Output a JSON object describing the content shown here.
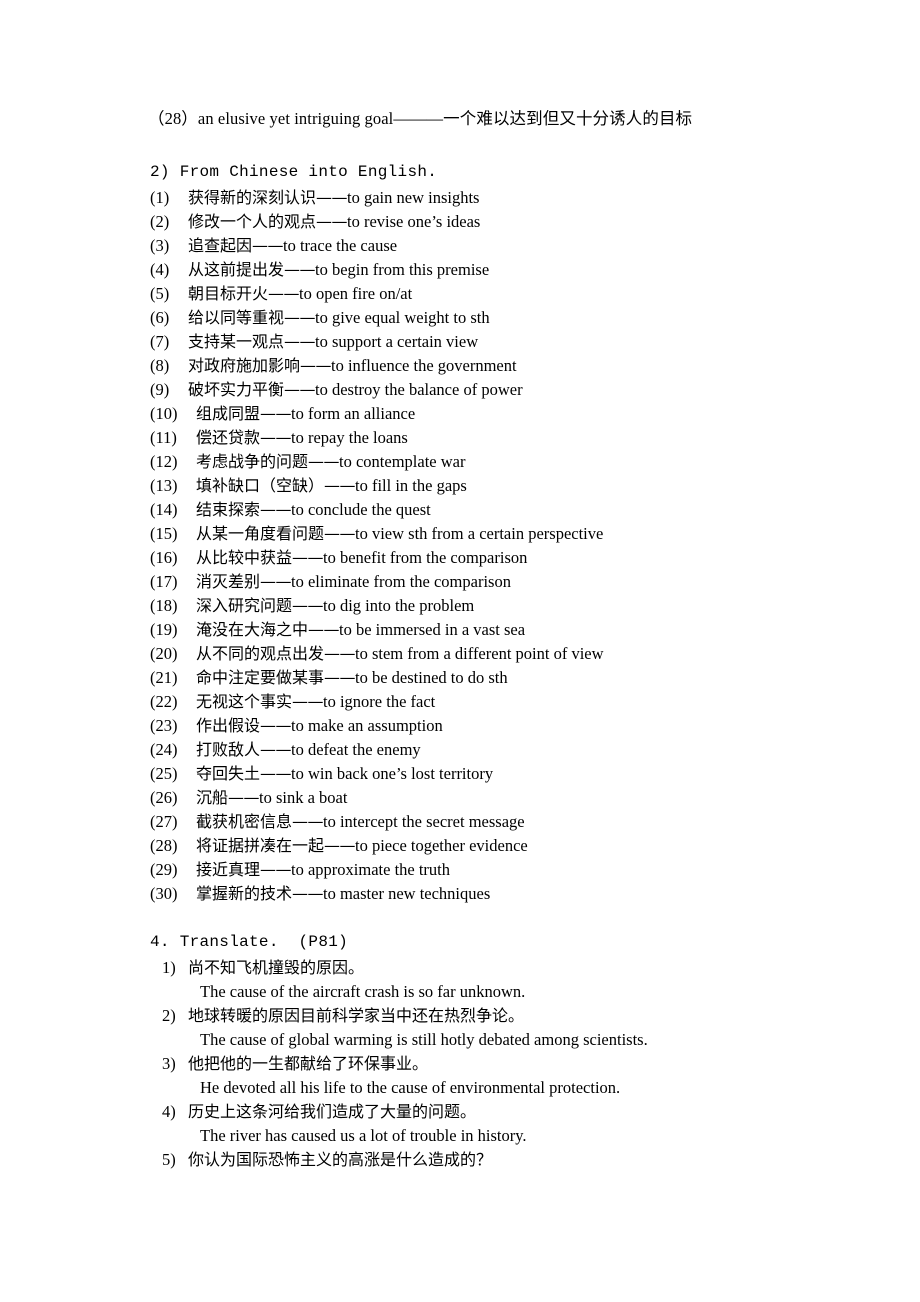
{
  "page": {
    "background_color": "#ffffff",
    "text_color": "#000000"
  },
  "top_line": {
    "text": "（28）an elusive yet intriguing goal———一个难以达到但又十分诱人的目标"
  },
  "sections": {
    "chinese_into_english": {
      "heading": "2) From Chinese into English.",
      "items": [
        {
          "num": "(1)",
          "cn": "获得新的深刻认识",
          "dash": "——",
          "en": "to gain new insights"
        },
        {
          "num": "(2)",
          "cn": "修改一个人的观点",
          "dash": "——",
          "en": "to revise one’s ideas"
        },
        {
          "num": "(3)",
          "cn": "追查起因",
          "dash": "——",
          "en": "to trace the cause"
        },
        {
          "num": "(4)",
          "cn": "从这前提出发",
          "dash": "——",
          "en": "to begin from this premise"
        },
        {
          "num": "(5)",
          "cn": "朝目标开火",
          "dash": "——",
          "en": "to open fire on/at"
        },
        {
          "num": "(6)",
          "cn": "给以同等重视",
          "dash": "——",
          "en": "to give equal weight to sth"
        },
        {
          "num": "(7)",
          "cn": "支持某一观点",
          "dash": "——",
          "en": "to support a certain view"
        },
        {
          "num": "(8)",
          "cn": "对政府施加影响",
          "dash": "——",
          "en": "to influence the government"
        },
        {
          "num": "(9)",
          "cn": "破坏实力平衡",
          "dash": "——",
          "en": "to destroy the balance of power"
        },
        {
          "num": "(10)",
          "cn": "组成同盟",
          "dash": "——",
          "en": "to form an alliance"
        },
        {
          "num": "(11)",
          "cn": "偿还贷款",
          "dash": "——",
          "en": "to repay the loans"
        },
        {
          "num": "(12)",
          "cn": "考虑战争的问题",
          "dash": "——",
          "en": "to contemplate war"
        },
        {
          "num": "(13)",
          "cn": "填补缺口（空缺）",
          "dash": "——",
          "en": "to fill in the gaps"
        },
        {
          "num": "(14)",
          "cn": "结束探索",
          "dash": "——",
          "en": "to conclude the quest"
        },
        {
          "num": "(15)",
          "cn": "从某一角度看问题",
          "dash": "——",
          "en": "to view sth from a certain perspective"
        },
        {
          "num": "(16)",
          "cn": "从比较中获益",
          "dash": "——",
          "en": "to benefit from the comparison"
        },
        {
          "num": "(17)",
          "cn": "消灭差别",
          "dash": "——",
          "en": "to eliminate from the comparison"
        },
        {
          "num": "(18)",
          "cn": "深入研究问题",
          "dash": "——",
          "en": "to dig into the problem"
        },
        {
          "num": "(19)",
          "cn": "淹没在大海之中",
          "dash": "——",
          "en": "to be immersed in a vast sea"
        },
        {
          "num": "(20)",
          "cn": "从不同的观点出发",
          "dash": "——",
          "en": "to stem from a different point of view"
        },
        {
          "num": "(21)",
          "cn": "命中注定要做某事",
          "dash": "——",
          "en": "to be destined to do sth"
        },
        {
          "num": "(22)",
          "cn": "无视这个事实",
          "dash": "——",
          "en": "to ignore the fact"
        },
        {
          "num": "(23)",
          "cn": "作出假设",
          "dash": "——",
          "en": "to make an assumption"
        },
        {
          "num": "(24)",
          "cn": "打败敌人",
          "dash": "——",
          "en": "to defeat the enemy"
        },
        {
          "num": "(25)",
          "cn": "夺回失土",
          "dash": "——",
          "en": "to win back one’s lost territory"
        },
        {
          "num": "(26)",
          "cn": "沉船",
          "dash": "——",
          "en": "to sink a boat"
        },
        {
          "num": "(27)",
          "cn": "截获机密信息",
          "dash": "——",
          "en": "to intercept the secret message"
        },
        {
          "num": "(28)",
          "cn": "将证据拼凑在一起",
          "dash": "——",
          "en": "to piece together evidence"
        },
        {
          "num": "(29)",
          "cn": "接近真理",
          "dash": "——",
          "en": "to approximate the truth"
        },
        {
          "num": "(30)",
          "cn": "掌握新的技术",
          "dash": "——",
          "en": "to master new techniques"
        }
      ]
    },
    "translate": {
      "heading": "4. Translate.  (P81)",
      "items": [
        {
          "num": "1)",
          "cn": "尚不知飞机撞毁的原因。",
          "en": "The cause of the aircraft crash is so far unknown."
        },
        {
          "num": "2)",
          "cn": "地球转暖的原因目前科学家当中还在热烈争论。",
          "en": "The cause of global warming is still hotly debated among scientists."
        },
        {
          "num": "3)",
          "cn": "他把他的一生都献给了环保事业。",
          "en": "He devoted all his life to the cause of environmental protection."
        },
        {
          "num": "4)",
          "cn": "历史上这条河给我们造成了大量的问题。",
          "en": "The river has caused us a lot of trouble in history."
        },
        {
          "num": "5)",
          "cn": "你认为国际恐怖主义的高涨是什么造成的？",
          "en": ""
        }
      ]
    }
  }
}
